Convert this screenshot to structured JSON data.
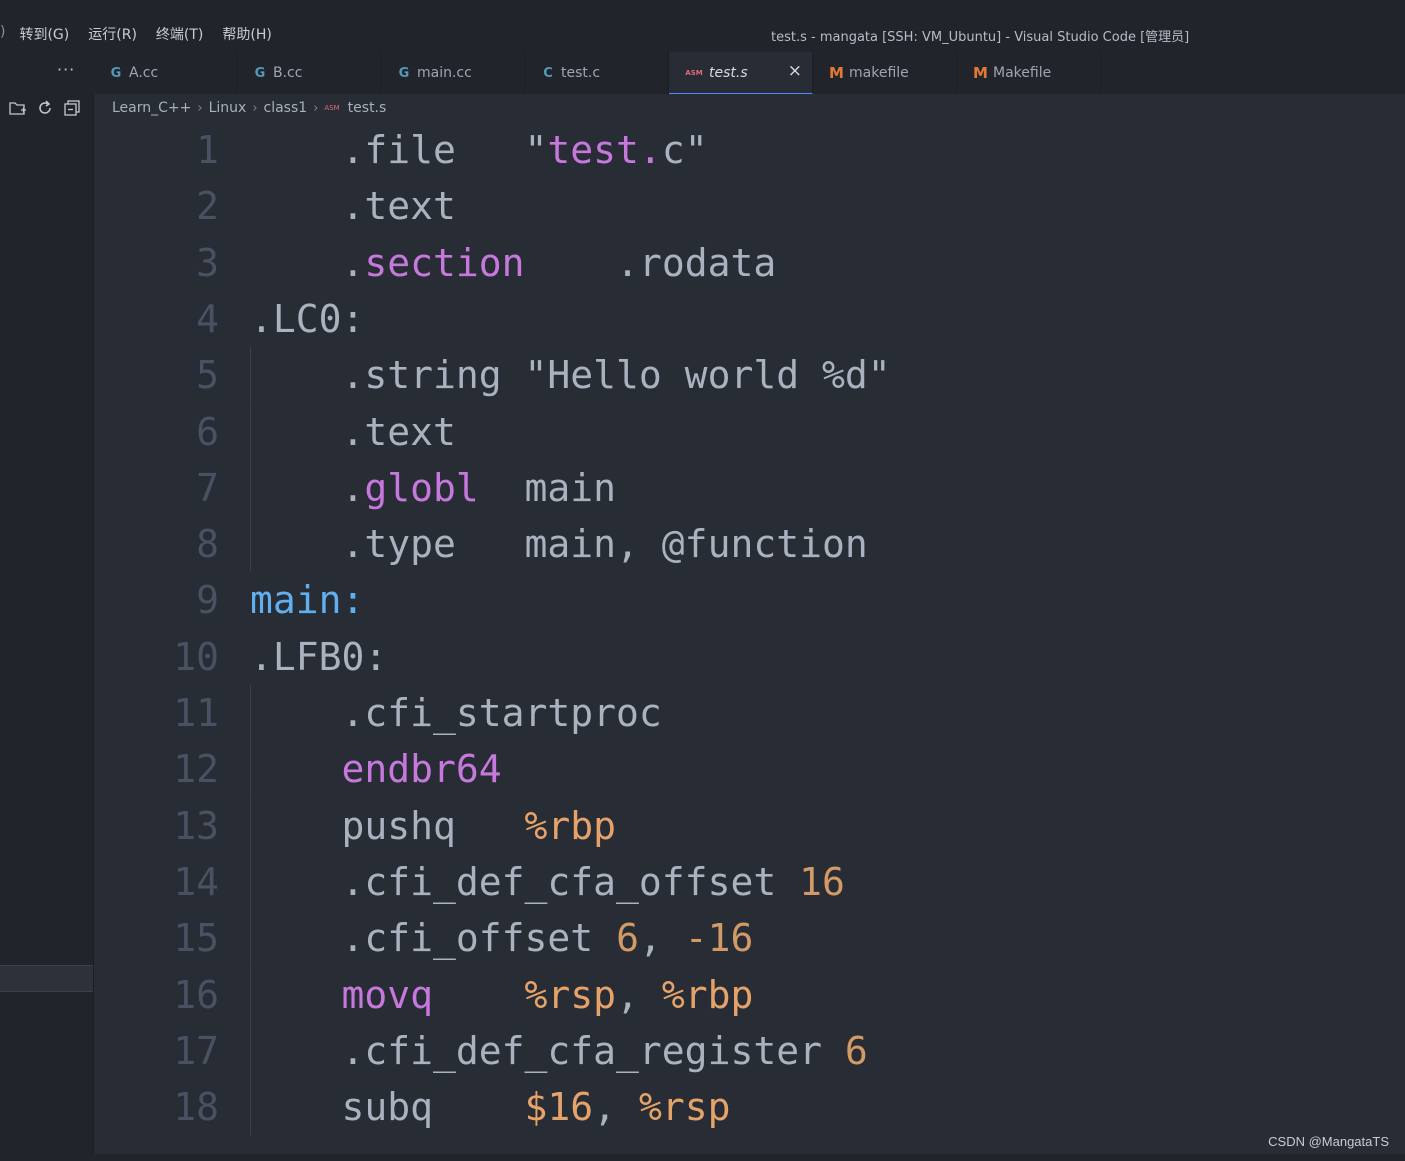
{
  "menu": {
    "items": [
      "转到(G)",
      "运行(R)",
      "终端(T)",
      "帮助(H)"
    ]
  },
  "window_title": "test.s - mangata [SSH: VM_Ubuntu] - Visual Studio Code [管理员]",
  "sidebar": {
    "more_label": "···"
  },
  "tabs": [
    {
      "label": "A.cc",
      "icon": "cpp-file-icon",
      "active": false
    },
    {
      "label": "B.cc",
      "icon": "cpp-file-icon",
      "active": false
    },
    {
      "label": "main.cc",
      "icon": "cpp-file-icon",
      "active": false
    },
    {
      "label": "test.c",
      "icon": "c-file-icon",
      "active": false
    },
    {
      "label": "test.s",
      "icon": "asm-file-icon",
      "active": true
    },
    {
      "label": "makefile",
      "icon": "makefile-icon",
      "active": false
    },
    {
      "label": "Makefile",
      "icon": "makefile-icon",
      "active": false
    }
  ],
  "tab_icons": {
    "cpp": "G",
    "c": "C",
    "asm": "ASM",
    "mk": "M",
    "close": "×"
  },
  "breadcrumb": {
    "items": [
      "Learn_C++",
      "Linux",
      "class1"
    ],
    "file": "test.s",
    "separator": "›"
  },
  "editor": {
    "lines": [
      {
        "n": "1",
        "tokens": [
          [
            "    ",
            "default"
          ],
          [
            ".file",
            "default"
          ],
          [
            "   \"",
            "default"
          ],
          [
            "test.",
            "directive"
          ],
          [
            "c\"",
            "default"
          ]
        ]
      },
      {
        "n": "2",
        "tokens": [
          [
            "    ",
            "default"
          ],
          [
            ".text",
            "default"
          ]
        ]
      },
      {
        "n": "3",
        "tokens": [
          [
            "    ",
            "default"
          ],
          [
            ".",
            "default"
          ],
          [
            "section",
            "directive"
          ],
          [
            "    .rodata",
            "default"
          ]
        ]
      },
      {
        "n": "4",
        "tokens": [
          [
            ".LC0:",
            "default"
          ]
        ]
      },
      {
        "n": "5",
        "tokens": [
          [
            "    ",
            "default"
          ],
          [
            ".string \"Hello world %d\"",
            "default"
          ]
        ]
      },
      {
        "n": "6",
        "tokens": [
          [
            "    ",
            "default"
          ],
          [
            ".text",
            "default"
          ]
        ]
      },
      {
        "n": "7",
        "tokens": [
          [
            "    ",
            "default"
          ],
          [
            ".",
            "default"
          ],
          [
            "globl",
            "directive"
          ],
          [
            "  main",
            "default"
          ]
        ]
      },
      {
        "n": "8",
        "tokens": [
          [
            "    ",
            "default"
          ],
          [
            ".type   main, @function",
            "default"
          ]
        ]
      },
      {
        "n": "9",
        "tokens": [
          [
            "main:",
            "label"
          ]
        ]
      },
      {
        "n": "10",
        "tokens": [
          [
            ".LFB0:",
            "default"
          ]
        ]
      },
      {
        "n": "11",
        "tokens": [
          [
            "    ",
            "default"
          ],
          [
            ".cfi_startproc",
            "default"
          ]
        ]
      },
      {
        "n": "12",
        "tokens": [
          [
            "    ",
            "default"
          ],
          [
            "endbr64",
            "directive"
          ]
        ]
      },
      {
        "n": "13",
        "tokens": [
          [
            "    ",
            "default"
          ],
          [
            "pushq   ",
            "default"
          ],
          [
            "%rbp",
            "reg"
          ]
        ]
      },
      {
        "n": "14",
        "tokens": [
          [
            "    ",
            "default"
          ],
          [
            ".cfi_def_cfa_offset ",
            "default"
          ],
          [
            "16",
            "num"
          ]
        ]
      },
      {
        "n": "15",
        "tokens": [
          [
            "    ",
            "default"
          ],
          [
            ".cfi_offset ",
            "default"
          ],
          [
            "6",
            "num"
          ],
          [
            ", ",
            "default"
          ],
          [
            "-16",
            "num"
          ]
        ]
      },
      {
        "n": "16",
        "tokens": [
          [
            "    ",
            "default"
          ],
          [
            "movq",
            "directive"
          ],
          [
            "    ",
            "default"
          ],
          [
            "%rsp",
            "reg"
          ],
          [
            ", ",
            "default"
          ],
          [
            "%rbp",
            "reg"
          ]
        ]
      },
      {
        "n": "17",
        "tokens": [
          [
            "    ",
            "default"
          ],
          [
            ".cfi_def_cfa_register ",
            "default"
          ],
          [
            "6",
            "num"
          ]
        ]
      },
      {
        "n": "18",
        "tokens": [
          [
            "    ",
            "default"
          ],
          [
            "subq    ",
            "default"
          ],
          [
            "$16",
            "reg"
          ],
          [
            ", ",
            "default"
          ],
          [
            "%rsp",
            "reg"
          ]
        ]
      }
    ]
  },
  "watermark": "CSDN @MangataTS",
  "colors": {
    "editor_bg": "#282c34",
    "chrome_bg": "#21252b",
    "directive": "#c678dd",
    "label": "#61afef",
    "register": "#e5a36a",
    "number": "#d19a66",
    "line_number": "#495162"
  }
}
